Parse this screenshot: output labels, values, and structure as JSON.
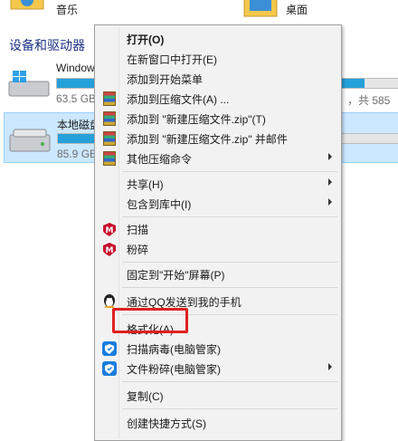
{
  "explorer": {
    "top_items": [
      {
        "label": "音乐",
        "icon": "music-folder-icon"
      },
      {
        "label": "桌面",
        "icon": "desktop-folder-icon"
      }
    ],
    "section_title": "设备和驱动器",
    "drives": [
      {
        "name": "Window",
        "size_text": "63.5 GB",
        "size_right": "，共 585",
        "used_fraction": 0.9,
        "selected": false
      },
      {
        "name": "本地磁盘",
        "size_text": "85.9 GB",
        "size_right": "",
        "used_fraction": 0.2,
        "selected": true
      }
    ]
  },
  "context_menu": {
    "items": [
      {
        "label": "打开(O)",
        "bold": true,
        "icon": "",
        "submenu": false
      },
      {
        "label": "在新窗口中打开(E)",
        "icon": "",
        "submenu": false
      },
      {
        "label": "添加到开始菜单",
        "icon": "",
        "submenu": false
      },
      {
        "label": "添加到压缩文件(A) ...",
        "icon": "winrar-archive-icon",
        "submenu": false
      },
      {
        "label": "添加到 \"新建压缩文件.zip\"(T)",
        "icon": "winrar-archive-icon",
        "submenu": false
      },
      {
        "label": "添加到 \"新建压缩文件.zip\" 并邮件",
        "icon": "winrar-archive-icon",
        "submenu": false
      },
      {
        "label": "其他压缩命令",
        "icon": "winrar-archive-icon",
        "submenu": true
      },
      {
        "label": "共享(H)",
        "icon": "",
        "submenu": true
      },
      {
        "label": "包含到库中(I)",
        "icon": "",
        "submenu": true
      },
      {
        "label": "扫描",
        "icon": "mcafee-icon",
        "submenu": false
      },
      {
        "label": "粉碎",
        "icon": "mcafee-icon",
        "submenu": false
      },
      {
        "label": "固定到\"开始\"屏幕(P)",
        "icon": "",
        "submenu": false
      },
      {
        "label": "通过QQ发送到我的手机",
        "icon": "qq-penguin-icon",
        "submenu": false
      },
      {
        "label": "格式化(A)...",
        "icon": "",
        "submenu": false
      },
      {
        "label": "扫描病毒(电脑管家)",
        "icon": "pc-manager-shield-icon",
        "submenu": false
      },
      {
        "label": "文件粉碎(电脑管家)",
        "icon": "pc-manager-shield-icon",
        "submenu": true
      },
      {
        "label": "复制(C)",
        "icon": "",
        "submenu": false
      },
      {
        "label": "创建快捷方式(S)",
        "icon": "",
        "submenu": false
      }
    ]
  },
  "colors": {
    "highlight_box": "#e02020",
    "drive_bar_fill": "#26a0da",
    "selected_drive_bg": "#cce8ff"
  }
}
